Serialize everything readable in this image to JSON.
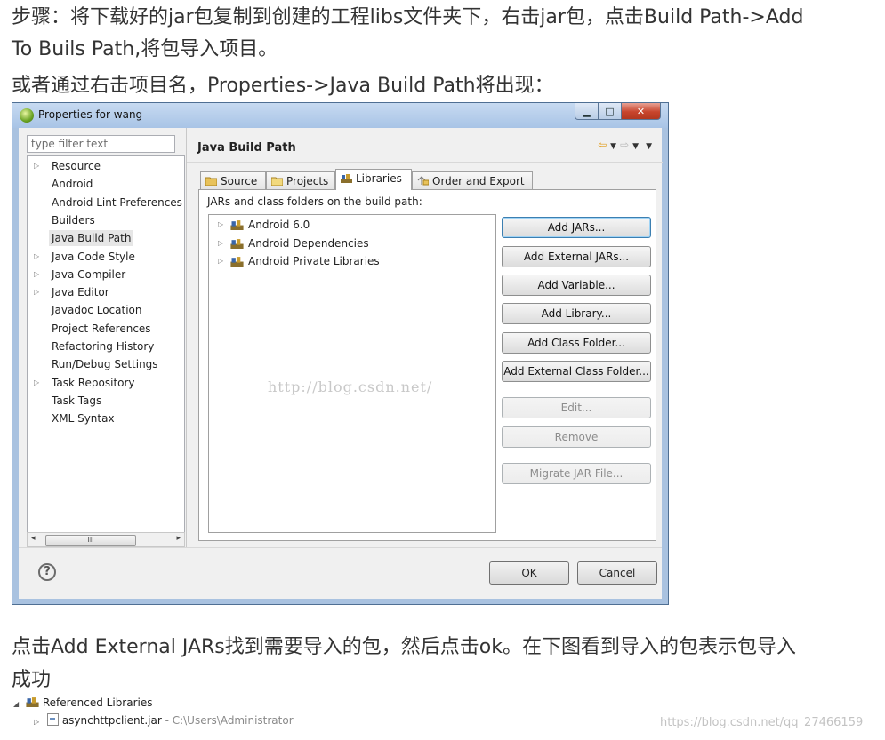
{
  "article": {
    "p1": "步骤：将下载好的jar包复制到创建的工程libs文件夹下，右击jar包，点击Build Path->Add",
    "p2": "To Buils Path,将包导入项目。",
    "p3": "或者通过右击项目名，Properties->Java Build Path将出现：",
    "p4": "点击Add External JARs找到需要导入的包，然后点击ok。在下图看到导入的包表示包导入",
    "p5": "成功"
  },
  "window": {
    "title": "Properties for wang",
    "min_glyph": "▁",
    "max_glyph": "□",
    "close_glyph": "✕"
  },
  "left": {
    "filter_placeholder": "type filter text",
    "items": [
      {
        "label": "Resource",
        "expandable": true
      },
      {
        "label": "Android",
        "expandable": false
      },
      {
        "label": "Android Lint Preferences",
        "expandable": false
      },
      {
        "label": "Builders",
        "expandable": false
      },
      {
        "label": "Java Build Path",
        "expandable": false,
        "selected": true
      },
      {
        "label": "Java Code Style",
        "expandable": true
      },
      {
        "label": "Java Compiler",
        "expandable": true
      },
      {
        "label": "Java Editor",
        "expandable": true
      },
      {
        "label": "Javadoc Location",
        "expandable": false
      },
      {
        "label": "Project References",
        "expandable": false
      },
      {
        "label": "Refactoring History",
        "expandable": false
      },
      {
        "label": "Run/Debug Settings",
        "expandable": false
      },
      {
        "label": "Task Repository",
        "expandable": true
      },
      {
        "label": "Task Tags",
        "expandable": false
      },
      {
        "label": "XML Syntax",
        "expandable": false
      }
    ],
    "scroll_thumb": "III"
  },
  "right": {
    "title": "Java Build Path",
    "tabs": [
      {
        "label": "Source"
      },
      {
        "label": "Projects"
      },
      {
        "label": "Libraries",
        "active": true
      },
      {
        "label": "Order and Export"
      }
    ],
    "jars_label": "JARs and class folders on the build path:",
    "libraries": [
      "Android 6.0",
      "Android Dependencies",
      "Android Private Libraries"
    ],
    "watermark": "http://blog.csdn.net/",
    "buttons": [
      {
        "label": "Add JARs...",
        "state": "focus"
      },
      {
        "label": "Add External JARs...",
        "state": "normal"
      },
      {
        "label": "Add Variable...",
        "state": "normal"
      },
      {
        "label": "Add Library...",
        "state": "normal"
      },
      {
        "label": "Add Class Folder...",
        "state": "normal"
      },
      {
        "label": "Add External Class Folder...",
        "state": "normal"
      },
      {
        "label": "Edit...",
        "state": "disabled"
      },
      {
        "label": "Remove",
        "state": "disabled"
      },
      {
        "label": "Migrate JAR File...",
        "state": "disabled"
      }
    ]
  },
  "footer": {
    "help": "?",
    "ok": "OK",
    "cancel": "Cancel"
  },
  "bottom_tree": {
    "referenced": "Referenced Libraries",
    "jar_name": "asynchttpclient.jar",
    "jar_path": " - C:\\Users\\Administrator",
    "watermark": "https://blog.csdn.net/qq_27466159"
  }
}
